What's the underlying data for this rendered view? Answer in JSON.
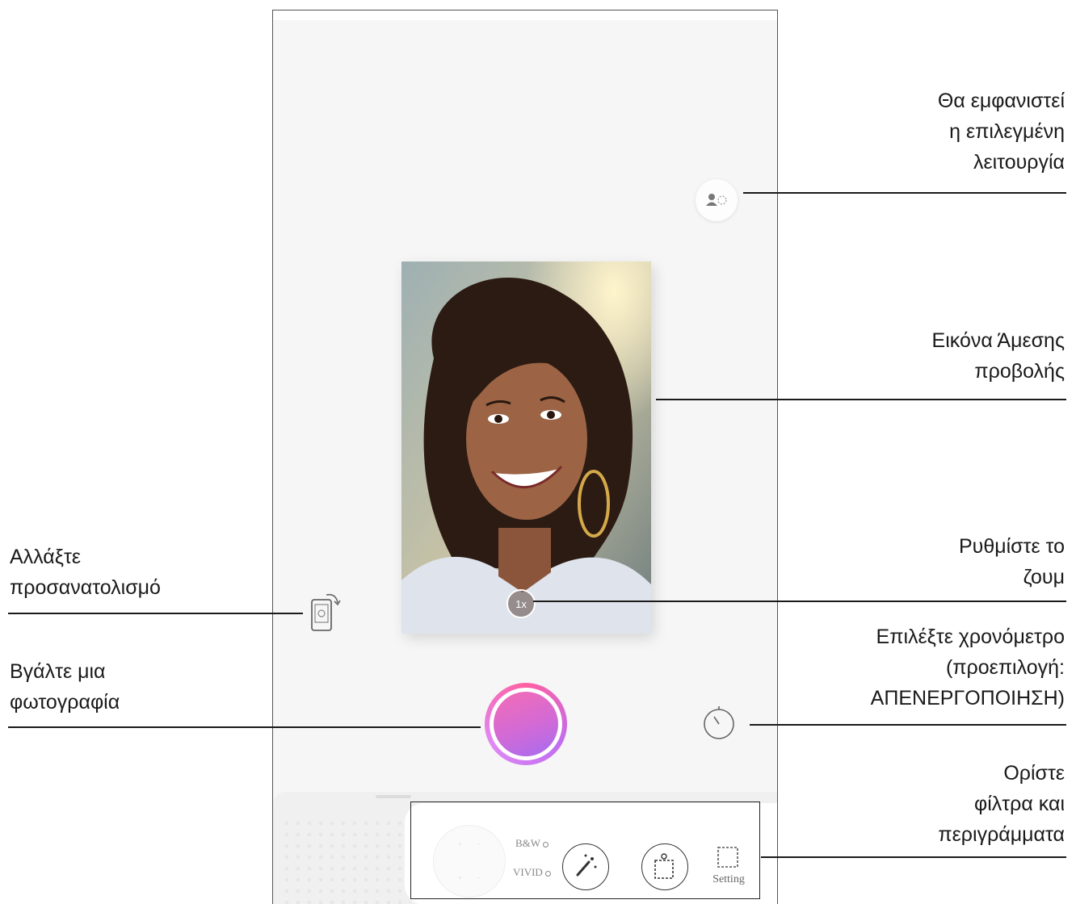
{
  "annotations": {
    "mode_display": [
      "Θα εμφανιστεί",
      "η επιλεγμένη",
      "λειτουργία"
    ],
    "live_view": [
      "Εικόνα Άμεσης",
      "προβολής"
    ],
    "orientation": [
      "Αλλάξτε",
      "προσανατολισμό"
    ],
    "zoom": [
      "Ρυθμίστε το",
      "ζουμ"
    ],
    "take_photo": [
      "Βγάλτε μια",
      "φωτογραφία"
    ],
    "timer": [
      "Επιλέξτε χρονόμετρο",
      "(προεπιλογή:",
      "ΑΠΕΝΕΡΓΟΠΟΙΗΣΗ)"
    ],
    "filters": [
      "Ορίστε",
      "φίλτρα και",
      "περιγράμματα"
    ]
  },
  "camera": {
    "zoom_label": "1x",
    "filter_options": [
      "B&W",
      "VIVID"
    ],
    "setting_label": "Setting",
    "joystick_marks": [
      "+",
      "–",
      "+",
      "–"
    ]
  },
  "icons": {
    "mode": "person-sparkle-icon",
    "rotate": "rotate-orientation-icon",
    "timer": "timer-icon",
    "filter": "magic-wand-icon",
    "frame": "frame-border-icon",
    "setting": "setting-square-icon"
  },
  "colors": {
    "shutter_start": "#f46cb4",
    "shutter_end": "#a56cf0",
    "background": "#f6f6f6"
  }
}
